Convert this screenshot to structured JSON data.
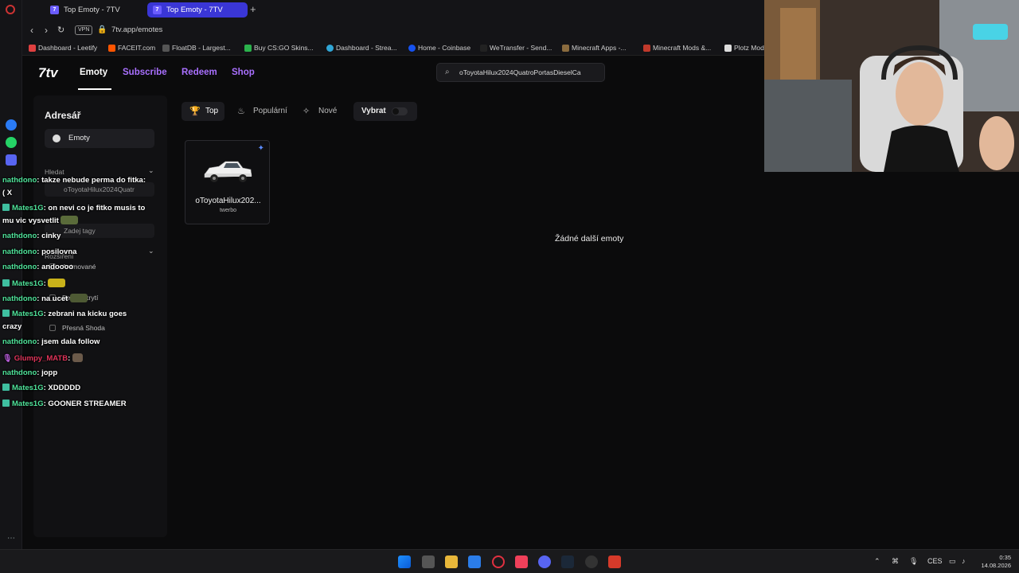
{
  "browser": {
    "tabs": [
      {
        "label": "Top Emoty - 7TV",
        "active": false
      },
      {
        "label": "Top Emoty - 7TV",
        "active": true
      }
    ],
    "url": "7tv.app/emotes",
    "vpn_label": "VPN",
    "bookmarks": [
      "Dashboard - Leetify",
      "FACEIT.com",
      "FloatDB - Largest...",
      "Buy CS:GO Skins...",
      "Dashboard - Strea...",
      "Home - Coinbase",
      "WeTransfer - Send...",
      "Minecraft Apps -...",
      "Minecraft Mods &...",
      "Plotz Mod"
    ]
  },
  "app": {
    "logo": "7tv",
    "nav": {
      "emoty": "Emoty",
      "subscribe": "Subscribe",
      "redeem": "Redeem",
      "shop": "Shop"
    },
    "search_value": "oToyotaHilux2024QuatroPortasDieselCa",
    "sidebar": {
      "title": "Adresář",
      "emoty": "Emoty",
      "hledat": "Hledat",
      "search_value": "oToyotaHilux2024Quatr",
      "tags_placeholder": "Zadej tagy",
      "rozsireni": "Rozšíření",
      "opt_animovane": "Animované",
      "opt_bez_prekryti": "Bez překrytí",
      "opt_presna_shoda": "Přesná Shoda"
    },
    "filters": {
      "top": "Top",
      "popularni": "Populární",
      "nove": "Nové",
      "vybrat": "Vybrat"
    },
    "emote": {
      "name": "oToyotaHilux202...",
      "author": "twerbo"
    },
    "no_more": "Žádné další emoty"
  },
  "chat": [
    {
      "user": "nathdono",
      "text": ": takze nebude perma do fitka:",
      "color": "#4fe39a",
      "badge": false
    },
    {
      "user": "",
      "text": "( X",
      "color": "#ffffff",
      "badge": false
    },
    {
      "user": "Mates1G",
      "text": ": on nevi co je fitko musis to",
      "color": "#4fe39a",
      "badge": true
    },
    {
      "user": "",
      "text": "mu vic vysvetlit",
      "color": "#ffffff",
      "badge": false
    },
    {
      "user": "nathdono",
      "text": ": cinky",
      "color": "#4fe39a",
      "badge": false
    },
    {
      "user": "nathdono",
      "text": ": posilovna",
      "color": "#4fe39a",
      "badge": false
    },
    {
      "user": "nathdono",
      "text": ": andoooo",
      "color": "#4fe39a",
      "badge": false
    },
    {
      "user": "Mates1G",
      "text": ":",
      "color": "#4fe39a",
      "badge": true
    },
    {
      "user": "nathdono",
      "text": ": na ucet",
      "color": "#4fe39a",
      "badge": false
    },
    {
      "user": "Mates1G",
      "text": ": zebrani na kicku goes",
      "color": "#4fe39a",
      "badge": true
    },
    {
      "user": "",
      "text": "crazy",
      "color": "#ffffff",
      "badge": false
    },
    {
      "user": "nathdono",
      "text": ": jsem dala follow",
      "color": "#4fe39a",
      "badge": false
    },
    {
      "user": "Glumpy_MATB",
      "text": ":",
      "color": "#e0345a",
      "badge": false
    },
    {
      "user": "nathdono",
      "text": ": jopp",
      "color": "#4fe39a",
      "badge": false
    },
    {
      "user": "Mates1G",
      "text": ": XDDDDD",
      "color": "#4fe39a",
      "badge": true
    },
    {
      "user": "Mates1G",
      "text": ": GOONER STREAMER",
      "color": "#4fe39a",
      "badge": true
    }
  ],
  "taskbar": {
    "lang": "CES",
    "time": "0:35",
    "date": "14.08.2026"
  },
  "colors": {
    "accent": "#a970ff",
    "tab_active": "#3a36d6",
    "chat_green": "#4fe39a"
  }
}
